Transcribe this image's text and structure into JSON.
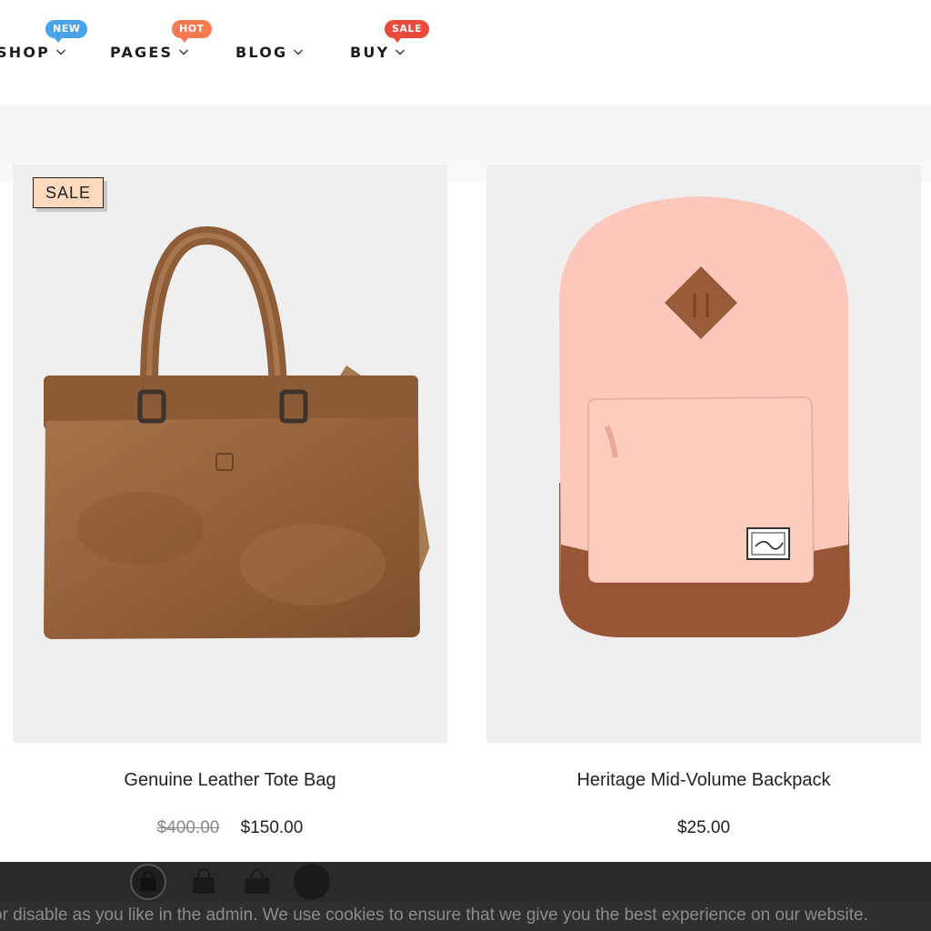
{
  "nav": {
    "items": [
      {
        "label": "SHOP",
        "badge": "NEW",
        "badge_color": "#4aa3e8"
      },
      {
        "label": "PAGES",
        "badge": "HOT",
        "badge_color": "#f47a52"
      },
      {
        "label": "BLOG",
        "badge": "",
        "badge_color": ""
      },
      {
        "label": "BUY",
        "badge": "SALE",
        "badge_color": "#ea4a3c"
      }
    ]
  },
  "products": [
    {
      "tag": "SALE",
      "title": "Genuine Leather Tote Bag",
      "old_price": "$400.00",
      "price": "$150.00",
      "image": "brown-leather-tote-bag"
    },
    {
      "tag": "",
      "title": "Heritage Mid-Volume Backpack",
      "old_price": "",
      "price": "$25.00",
      "image": "pink-backpack"
    }
  ],
  "swatches": [
    "tote-black-round",
    "tote-black",
    "tote-black-alt",
    "black-circle"
  ],
  "cookie_notice": "or disable as you like in the admin. We use cookies to ensure that we give you the best experience on our website."
}
